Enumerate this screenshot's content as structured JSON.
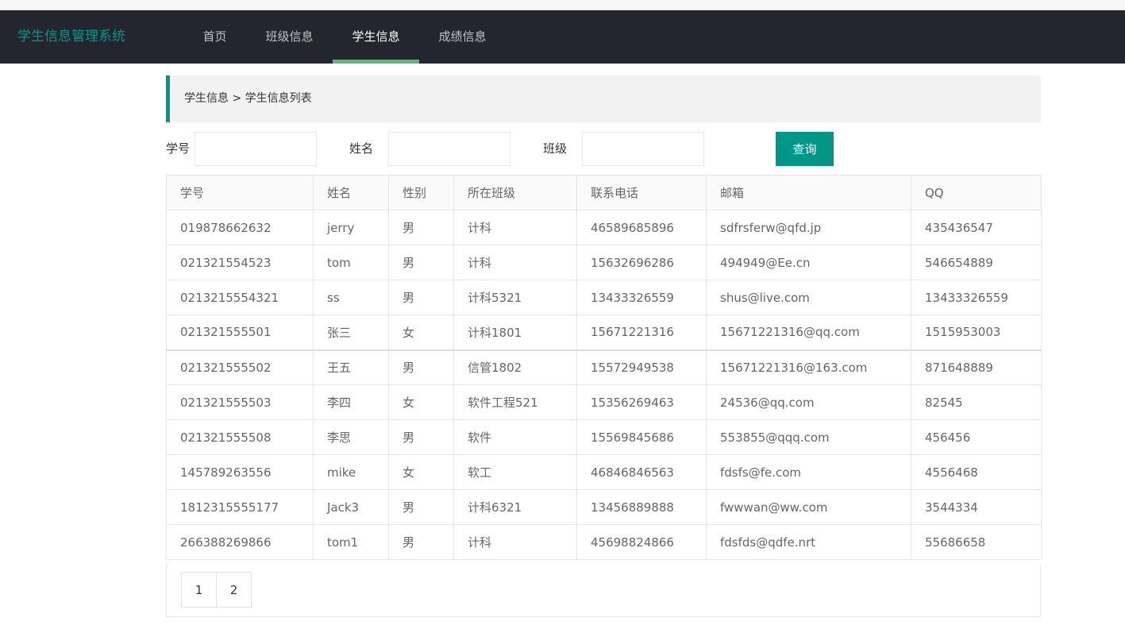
{
  "header": {
    "logo": "学生信息管理系统",
    "nav": [
      {
        "label": "首页"
      },
      {
        "label": "班级信息"
      },
      {
        "label": "学生信息"
      },
      {
        "label": "成绩信息"
      }
    ],
    "active_index": 2
  },
  "breadcrumb": "学生信息 > 学生信息列表",
  "search": {
    "id_label": "学号",
    "id_value": "",
    "name_label": "姓名",
    "name_value": "",
    "class_label": "班级",
    "class_value": "",
    "button_label": "查询"
  },
  "table": {
    "columns": [
      "学号",
      "姓名",
      "性别",
      "所在班级",
      "联系电话",
      "邮箱",
      "QQ"
    ],
    "rows": [
      [
        "019878662632",
        "jerry",
        "男",
        "计科",
        "46589685896",
        "sdfrsferw@qfd.jp",
        "435436547"
      ],
      [
        "021321554523",
        "tom",
        "男",
        "计科",
        "15632696286",
        "494949@Ee.cn",
        "546654889"
      ],
      [
        "0213215554321",
        "ss",
        "男",
        "计科5321",
        "13433326559",
        "shus@live.com",
        "13433326559"
      ],
      [
        "021321555501",
        "张三",
        "女",
        "计科1801",
        "15671221316",
        "15671221316@qq.com",
        "1515953003"
      ],
      [
        "021321555502",
        "王五",
        "男",
        "信管1802",
        "15572949538",
        "15671221316@163.com",
        "871648889"
      ],
      [
        "021321555503",
        "李四",
        "女",
        "软件工程521",
        "15356269463",
        "24536@qq.com",
        "82545"
      ],
      [
        "021321555508",
        "李思",
        "男",
        "软件",
        "15569845686",
        "553855@qqq.com",
        "456456"
      ],
      [
        "145789263556",
        "mike",
        "女",
        "软工",
        "46846846563",
        "fdsfs@fe.com",
        "4556468"
      ],
      [
        "1812315555177",
        "Jack3",
        "男",
        "计科6321",
        "13456889888",
        "fwwwan@ww.com",
        "3544334"
      ],
      [
        "266388269866",
        "tom1",
        "男",
        "计科",
        "45698824866",
        "fdsfds@qdfe.nrt",
        "55686658"
      ]
    ]
  },
  "pagination": {
    "pages": [
      "1",
      "2"
    ]
  },
  "colors": {
    "header_bg": "#23262e",
    "accent": "#009688",
    "nav_active_bar": "#5fb878"
  }
}
